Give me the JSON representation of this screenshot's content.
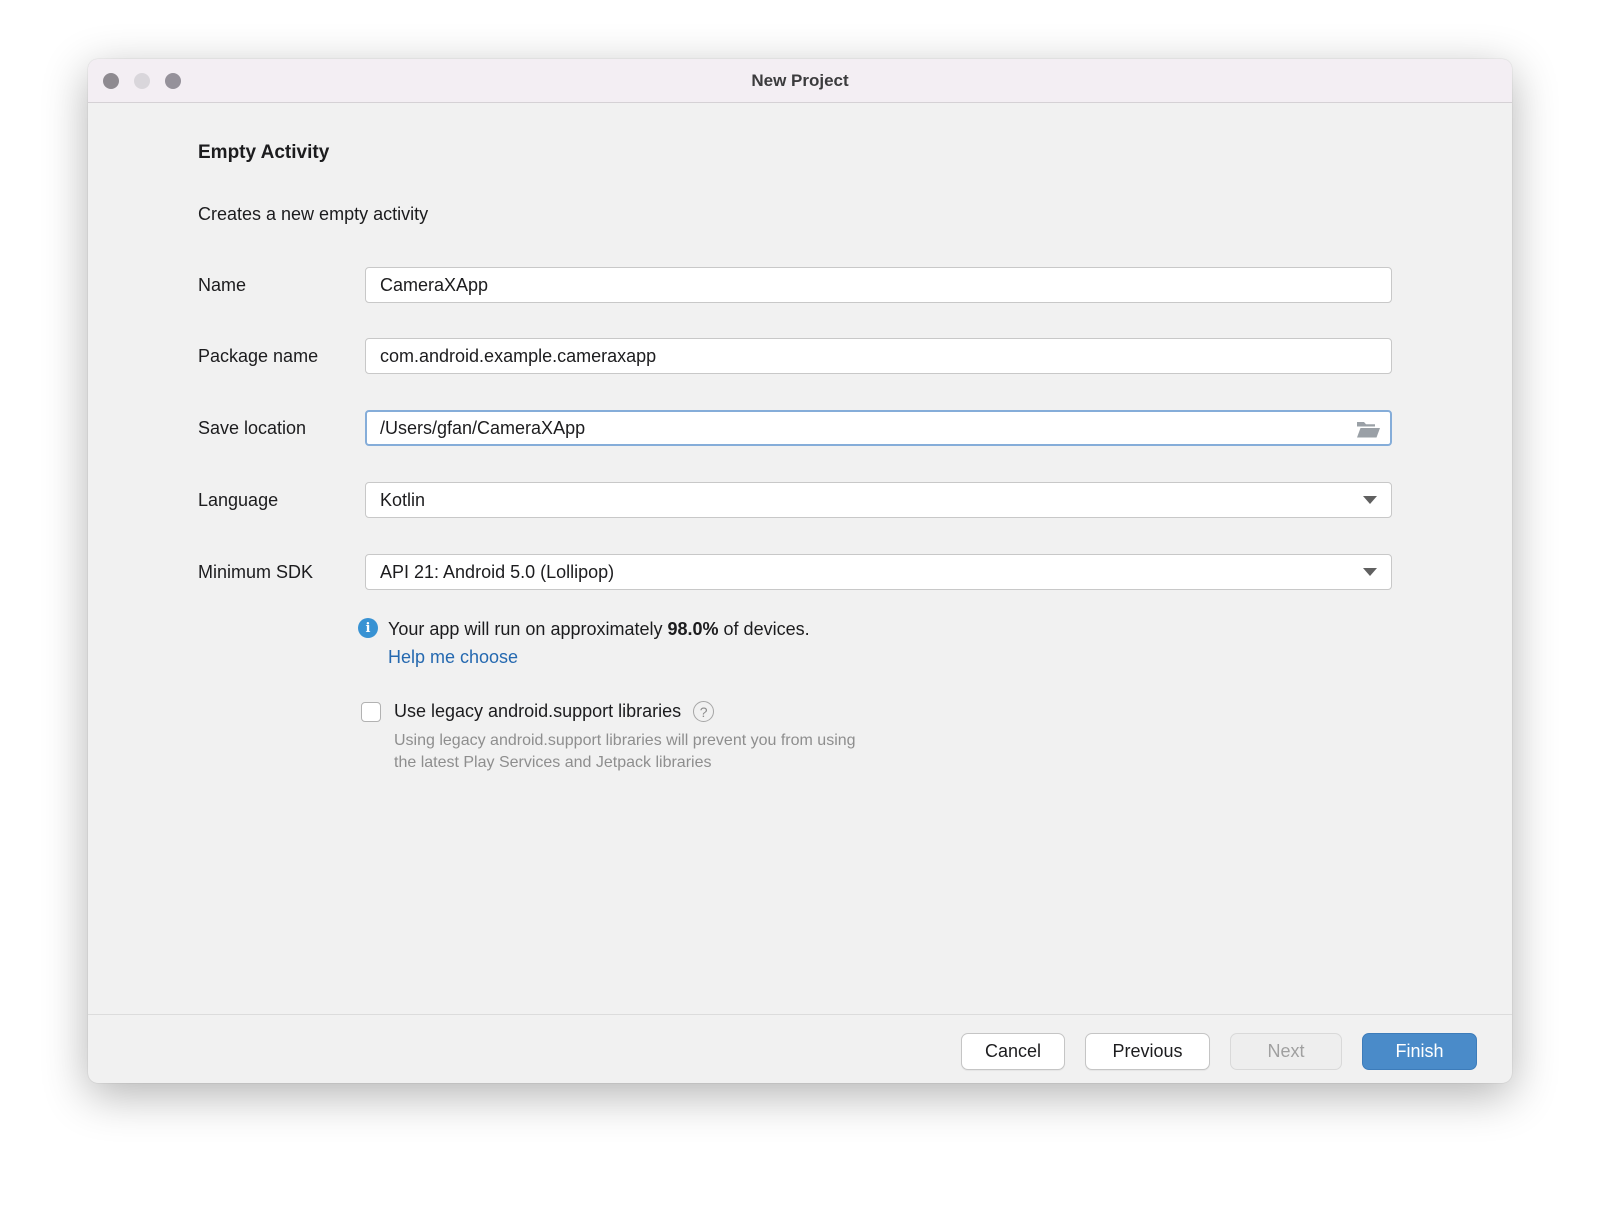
{
  "window": {
    "title": "New Project"
  },
  "header": {
    "title": "Empty Activity",
    "subtitle": "Creates a new empty activity"
  },
  "form": {
    "name": {
      "label": "Name",
      "value": "CameraXApp"
    },
    "package": {
      "label": "Package name",
      "value": "com.android.example.cameraxapp"
    },
    "save_location": {
      "label": "Save location",
      "value": "/Users/gfan/CameraXApp"
    },
    "language": {
      "label": "Language",
      "value": "Kotlin"
    },
    "min_sdk": {
      "label": "Minimum SDK",
      "value": "API 21: Android 5.0 (Lollipop)"
    }
  },
  "sdk_info": {
    "info_icon": "i",
    "text_prefix": "Your app will run on approximately ",
    "percent": "98.0%",
    "text_suffix": " of devices.",
    "link": "Help me choose"
  },
  "legacy": {
    "label": "Use legacy android.support libraries",
    "checked": false,
    "help_icon": "?",
    "help_line1": "Using legacy android.support libraries will prevent you from using",
    "help_line2": "the latest Play Services and Jetpack libraries"
  },
  "footer": {
    "cancel": "Cancel",
    "previous": "Previous",
    "next": "Next",
    "finish": "Finish"
  },
  "colors": {
    "primary_button": "#4a8bc9",
    "link": "#2569b0",
    "info_icon": "#3892d3",
    "focus_border": "#85add9"
  }
}
